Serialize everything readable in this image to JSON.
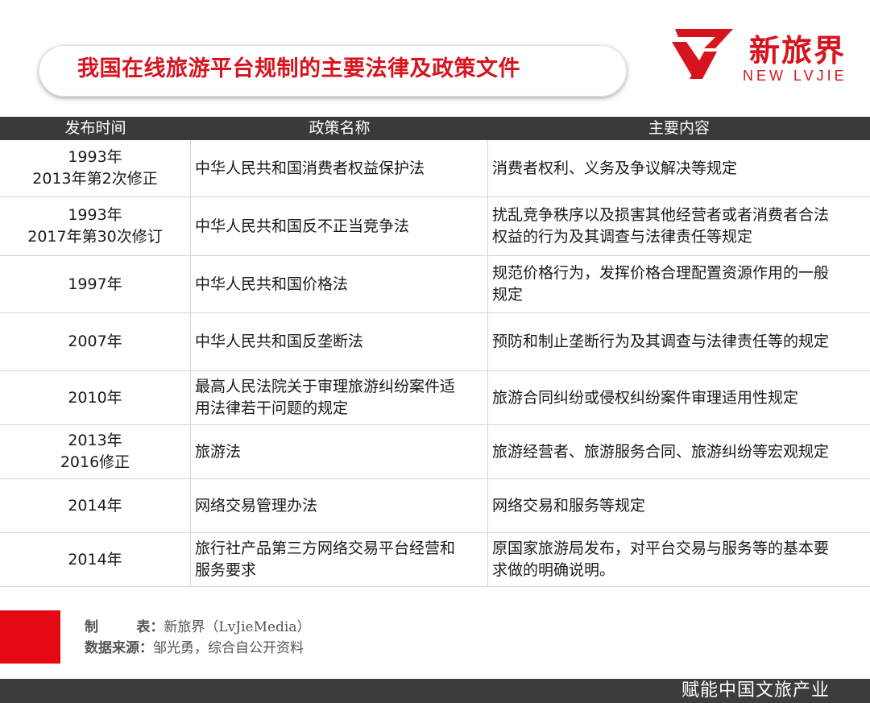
{
  "title": "我国在线旅游平台规制的主要法律及政策文件",
  "logo": {
    "cn": "新旅界",
    "en": "NEW LVJIE",
    "color": "#d7141e"
  },
  "table": {
    "headers": [
      "发布时间",
      "政策名称",
      "主要内容"
    ],
    "rows": [
      {
        "date": [
          "1993年",
          "2013年第2次修正"
        ],
        "name": [
          "中华人民共和国消费者权益保护法"
        ],
        "content": [
          "消费者权利、义务及争议解决等规定"
        ]
      },
      {
        "date": [
          "1993年",
          "2017年第30次修订"
        ],
        "name": [
          "中华人民共和国反不正当竞争法"
        ],
        "content": [
          "扰乱竞争秩序以及损害其他经营者或者消费者合法",
          "权益的行为及其调查与法律责任等规定"
        ]
      },
      {
        "date": [
          "1997年"
        ],
        "name": [
          "中华人民共和国价格法"
        ],
        "content": [
          "规范价格行为，发挥价格合理配置资源作用的一般",
          "规定"
        ]
      },
      {
        "date": [
          "2007年"
        ],
        "name": [
          "中华人民共和国反垄断法"
        ],
        "content": [
          "预防和制止垄断行为及其调查与法律责任等的规定"
        ]
      },
      {
        "date": [
          "2010年"
        ],
        "name": [
          "最高人民法院关于审理旅游纠纷案件适",
          "用法律若干问题的规定"
        ],
        "content": [
          "旅游合同纠纷或侵权纠纷案件审理适用性规定"
        ]
      },
      {
        "date": [
          "2013年",
          "2016修正"
        ],
        "name": [
          "旅游法"
        ],
        "content": [
          "旅游经营者、旅游服务合同、旅游纠纷等宏观规定"
        ]
      },
      {
        "date": [
          "2014年"
        ],
        "name": [
          "网络交易管理办法"
        ],
        "content": [
          "网络交易和服务等规定"
        ]
      },
      {
        "date": [
          "2014年"
        ],
        "name": [
          "旅行社产品第三方网络交易平台经营和",
          "服务要求"
        ],
        "content": [
          "原国家旅游局发布，对平台交易与服务等的基本要",
          "求做的明确说明。"
        ]
      }
    ]
  },
  "source": {
    "maker_label": "制        表：",
    "maker_value": "新旅界（LvJieMedia）",
    "data_label": "数据来源：",
    "data_value": "邹光勇，综合自公开资料"
  },
  "footer": {
    "slogan": "赋能中国文旅产业"
  },
  "colors": {
    "accent": "#e50914",
    "header_bg": "#3a3a3a",
    "bar_bg": "#3d3d3d"
  }
}
